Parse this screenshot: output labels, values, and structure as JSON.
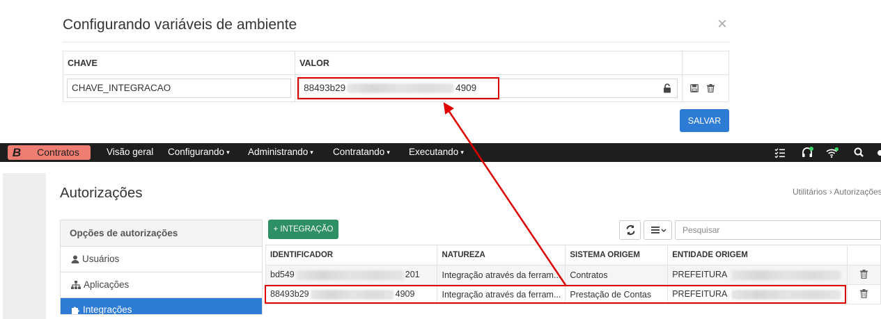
{
  "dialog": {
    "title": "Configurando variáveis de ambiente",
    "close_label": "×",
    "table": {
      "headers": [
        "CHAVE",
        "VALOR"
      ],
      "row": {
        "key": "CHAVE_INTEGRACAO",
        "value_start": "88493b29",
        "value_end": "4909"
      }
    },
    "save_label": "SALVAR"
  },
  "navbar": {
    "brand_letter": "B",
    "brand_name": "Contratos",
    "items": [
      {
        "label": "Visão geral",
        "caret": ""
      },
      {
        "label": "Configurando",
        "caret": "▾"
      },
      {
        "label": "Administrando",
        "caret": "▾"
      },
      {
        "label": "Contratando",
        "caret": "▾"
      },
      {
        "label": "Executando",
        "caret": "▾"
      }
    ],
    "status_colors": {
      "headset": "#3dd66b",
      "wifi": "#3dd66b"
    }
  },
  "page": {
    "title": "Autorizações",
    "breadcrumb": {
      "root": "Utilitários",
      "sep": "›",
      "current": "Autorizações"
    }
  },
  "sidebar": {
    "heading": "Opções de autorizações",
    "items": [
      {
        "label": "Usuários",
        "icon": "user-icon"
      },
      {
        "label": "Aplicações",
        "icon": "sitemap-icon"
      },
      {
        "label": "Integrações",
        "icon": "puzzle-icon"
      }
    ]
  },
  "toolbar": {
    "add_label": "+ INTEGRAÇÃO",
    "search_placeholder": "Pesquisar"
  },
  "grid": {
    "headers": [
      "IDENTIFICADOR",
      "NATUREZA",
      "SISTEMA ORIGEM",
      "ENTIDADE ORIGEM"
    ],
    "rows": [
      {
        "id_start": "bd549",
        "id_end": "201",
        "natureza": "Integração através da ferram...",
        "sistema": "Contratos",
        "entidade": "PREFEITURA"
      },
      {
        "id_start": "88493b29",
        "id_end": "4909",
        "natureza": "Integração através da ferram...",
        "sistema": "Prestação de Contas",
        "entidade": "PREFEITURA"
      }
    ]
  },
  "colors": {
    "accent": "#2d7bd4",
    "success": "#2e8f64",
    "brand": "#f07d72",
    "highlight": "#e00000"
  }
}
